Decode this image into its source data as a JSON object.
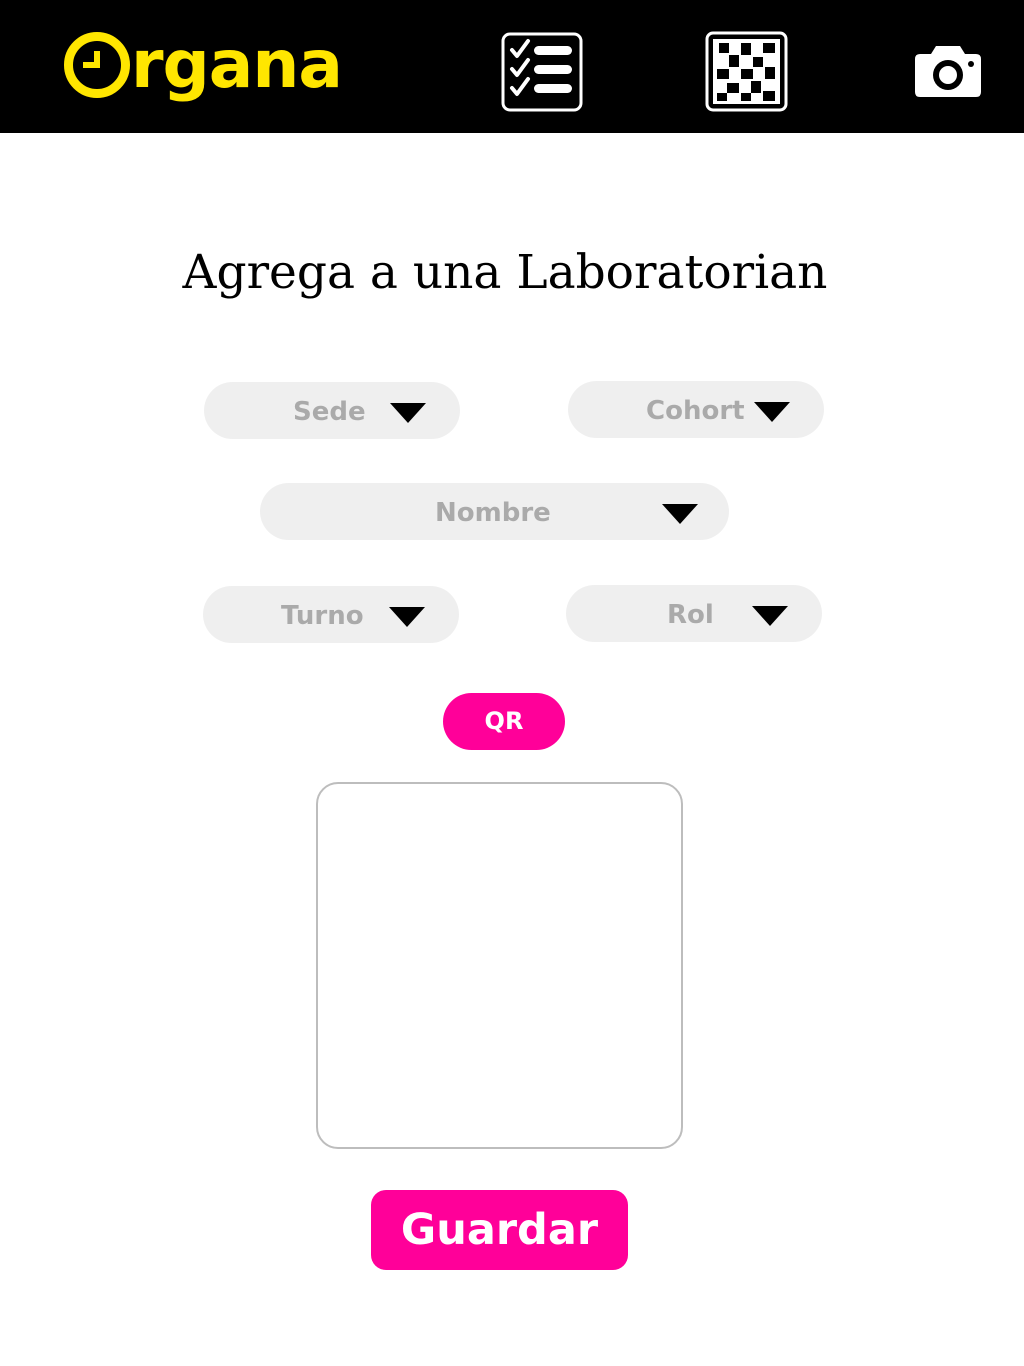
{
  "header": {
    "brand": {
      "name": "rgana",
      "logo_icon": "clock-o-icon",
      "color": "#ffe600"
    },
    "background": "#000000",
    "nav": [
      {
        "icon": "checklist-icon"
      },
      {
        "icon": "qr-code-icon"
      },
      {
        "icon": "camera-icon"
      }
    ]
  },
  "main": {
    "title": "Agrega a una Laboratorian",
    "fields": {
      "sede": "Sede",
      "cohort": "Cohort",
      "nombre": "Nombre",
      "turno": "Turno",
      "rol": "Rol"
    },
    "qr_button": "QR",
    "save_button": "Guardar"
  },
  "colors": {
    "accent": "#ff0099",
    "field_bg": "#efefef",
    "placeholder": "#aaaaaa"
  }
}
